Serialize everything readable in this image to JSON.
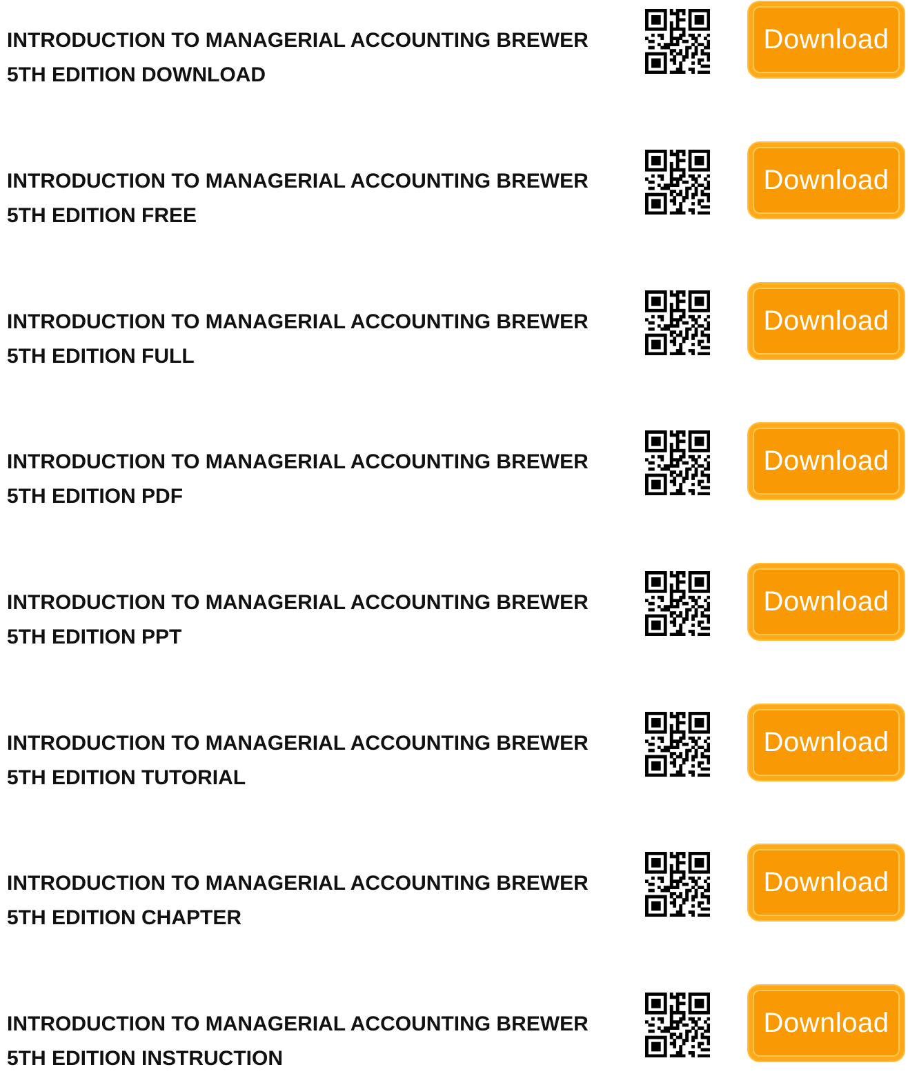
{
  "listings": [
    {
      "line1": "INTRODUCTION TO MANAGERIAL ACCOUNTING BREWER",
      "line2": "5TH EDITION DOWNLOAD",
      "button_label": "Download"
    },
    {
      "line1": "INTRODUCTION TO MANAGERIAL ACCOUNTING BREWER",
      "line2": "5TH EDITION FREE",
      "button_label": "Download"
    },
    {
      "line1": "INTRODUCTION TO MANAGERIAL ACCOUNTING BREWER",
      "line2": "5TH EDITION FULL",
      "button_label": "Download"
    },
    {
      "line1": "INTRODUCTION TO MANAGERIAL ACCOUNTING BREWER",
      "line2": "5TH EDITION PDF",
      "button_label": "Download"
    },
    {
      "line1": "INTRODUCTION TO MANAGERIAL ACCOUNTING BREWER",
      "line2": "5TH EDITION PPT",
      "button_label": "Download"
    },
    {
      "line1": "INTRODUCTION TO MANAGERIAL ACCOUNTING BREWER",
      "line2": "5TH EDITION TUTORIAL",
      "button_label": "Download"
    },
    {
      "line1": "INTRODUCTION TO MANAGERIAL ACCOUNTING BREWER",
      "line2": "5TH EDITION CHAPTER",
      "button_label": "Download"
    },
    {
      "line1": "INTRODUCTION TO MANAGERIAL ACCOUNTING BREWER",
      "line2": "5TH EDITION INSTRUCTION",
      "button_label": "Download"
    }
  ],
  "qr_icon": "qr-code-icon",
  "colors": {
    "button_fill": "#f99a05",
    "button_border": "#ffbf3c",
    "button_text": "#ffffff",
    "title_text": "#111111"
  }
}
